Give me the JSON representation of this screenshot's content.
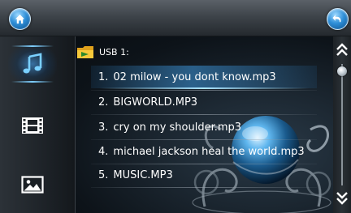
{
  "header": {
    "home_icon": "home-icon",
    "back_icon": "back-arrow-icon"
  },
  "sidebar": {
    "items": [
      {
        "name": "music",
        "icon": "music-note-icon",
        "active": true
      },
      {
        "name": "video",
        "icon": "film-strip-icon",
        "active": false
      },
      {
        "name": "photo",
        "icon": "picture-icon",
        "active": false
      }
    ]
  },
  "browser": {
    "path": "USB 1:",
    "files": [
      {
        "num": "1.",
        "name": "02 milow - you dont know.mp3",
        "selected": true
      },
      {
        "num": "2.",
        "name": "BIGWORLD.MP3",
        "selected": false
      },
      {
        "num": "3.",
        "name": "cry on my shoulder.mp3",
        "selected": false
      },
      {
        "num": "4.",
        "name": "michael jackson  heal the world.mp3",
        "selected": false
      },
      {
        "num": "5.",
        "name": "MUSIC.MP3",
        "selected": false
      }
    ]
  },
  "scroll": {
    "up_icon": "double-chevron-up-icon",
    "down_icon": "double-chevron-down-icon",
    "position": 0
  },
  "colors": {
    "accent": "#3fa0ec",
    "text": "#ffffff",
    "background": "#0d1319"
  }
}
